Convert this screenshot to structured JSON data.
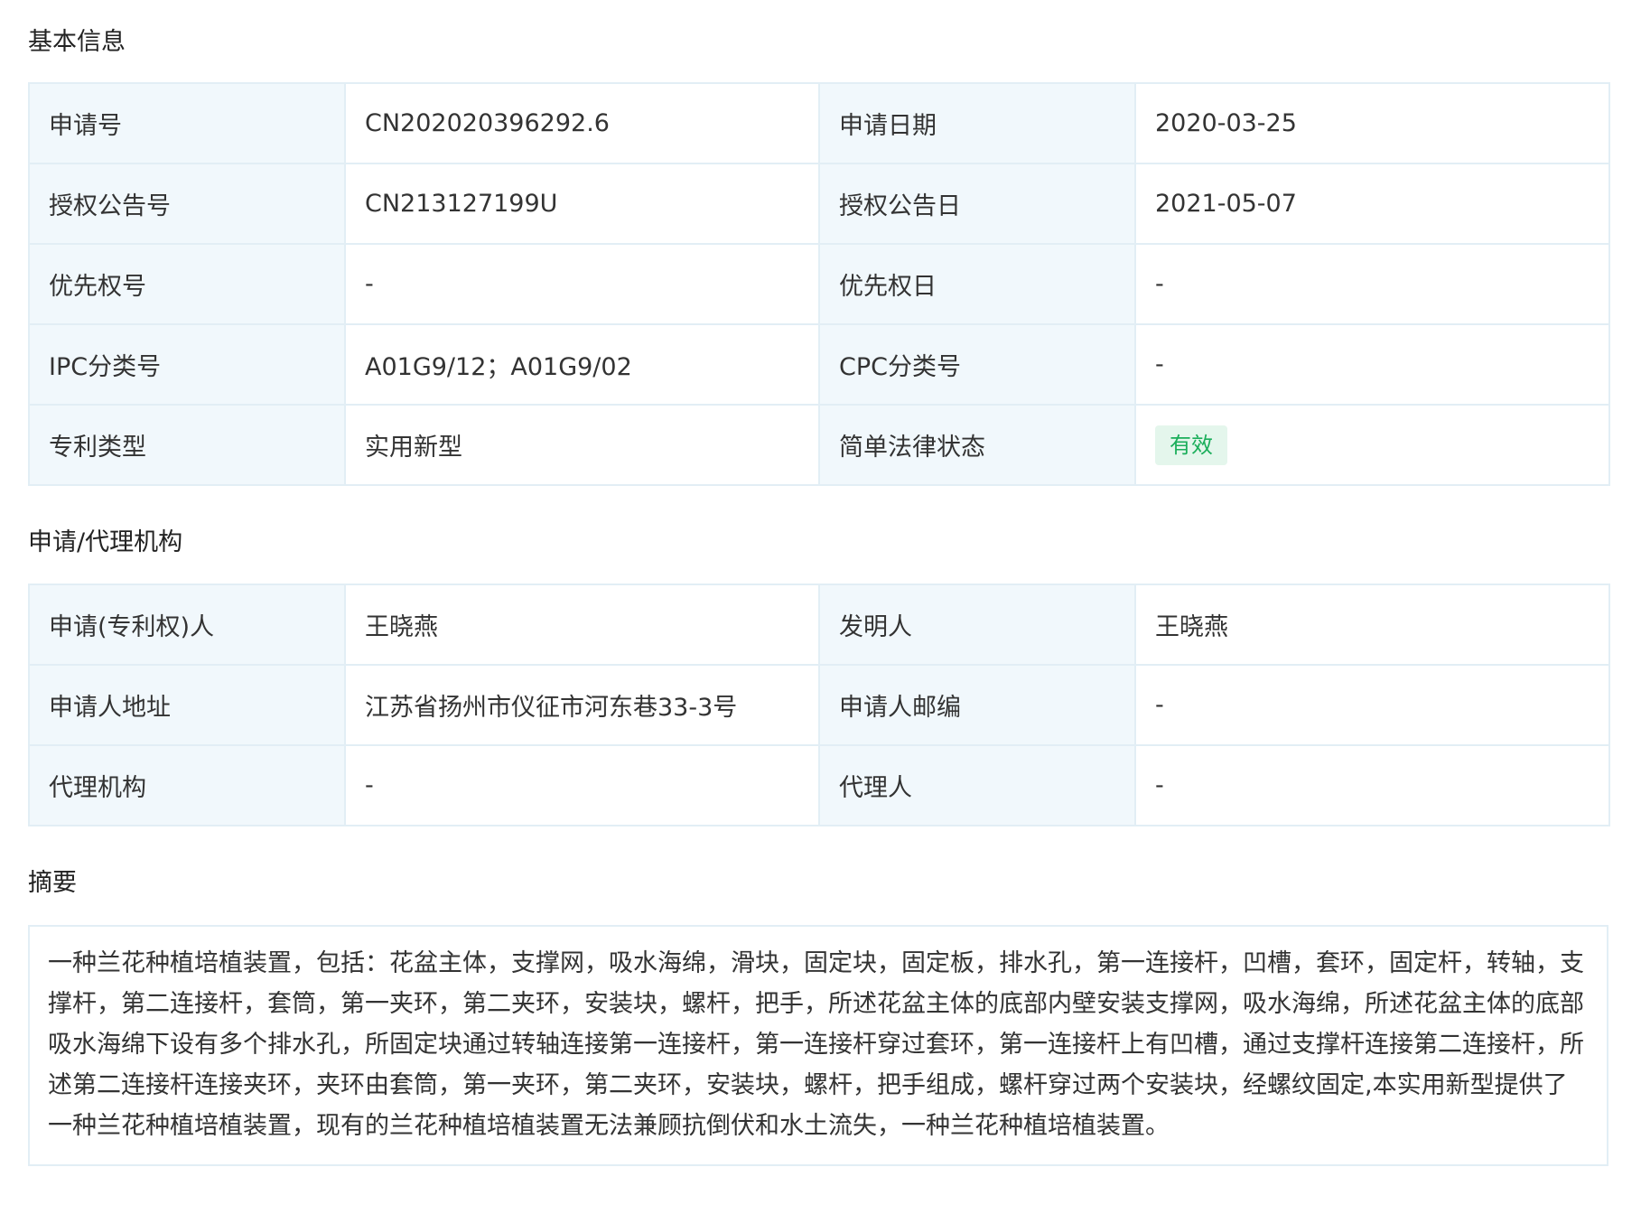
{
  "sections": {
    "basic": {
      "title": "基本信息",
      "rows": [
        {
          "l1": "申请号",
          "v1": "CN202020396292.6",
          "l2": "申请日期",
          "v2": "2020-03-25"
        },
        {
          "l1": "授权公告号",
          "v1": "CN213127199U",
          "l2": "授权公告日",
          "v2": "2021-05-07"
        },
        {
          "l1": "优先权号",
          "v1": "-",
          "l2": "优先权日",
          "v2": "-"
        },
        {
          "l1": "IPC分类号",
          "v1": "A01G9/12；A01G9/02",
          "l2": "CPC分类号",
          "v2": "-"
        },
        {
          "l1": "专利类型",
          "v1": "实用新型",
          "l2": "简单法律状态",
          "v2": "有效"
        }
      ]
    },
    "agency": {
      "title": "申请/代理机构",
      "rows": [
        {
          "l1": "申请(专利权)人",
          "v1": "王晓燕",
          "l2": "发明人",
          "v2": "王晓燕"
        },
        {
          "l1": "申请人地址",
          "v1": "江苏省扬州市仪征市河东巷33-3号",
          "l2": "申请人邮编",
          "v2": "-"
        },
        {
          "l1": "代理机构",
          "v1": "-",
          "l2": "代理人",
          "v2": "-"
        }
      ]
    },
    "abstract": {
      "title": "摘要",
      "text": "一种兰花种植培植装置，包括：花盆主体，支撑网，吸水海绵，滑块，固定块，固定板，排水孔，第一连接杆，凹槽，套环，固定杆，转轴，支撑杆，第二连接杆，套筒，第一夹环，第二夹环，安装块，螺杆，把手，所述花盆主体的底部内壁安装支撑网，吸水海绵，所述花盆主体的底部吸水海绵下设有多个排水孔，所固定块通过转轴连接第一连接杆，第一连接杆穿过套环，第一连接杆上有凹槽，通过支撑杆连接第二连接杆，所述第二连接杆连接夹环，夹环由套筒，第一夹环，第二夹环，安装块，螺杆，把手组成，螺杆穿过两个安装块，经螺纹固定,本实用新型提供了一种兰花种植培植装置，现有的兰花种植培植装置无法兼顾抗倒伏和水土流失，一种兰花种植培植装置。"
    }
  },
  "colors": {
    "label_bg": "#f1f8fc",
    "border": "#e2eef5",
    "status_green": "#1aae5a",
    "status_bg": "#e4f6ec"
  }
}
